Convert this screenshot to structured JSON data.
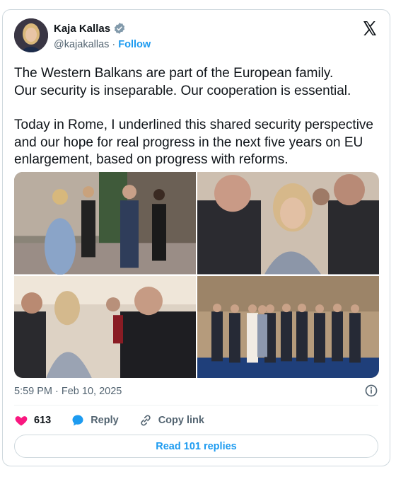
{
  "author": {
    "name": "Kaja Kallas",
    "handle": "@kajakallas",
    "separator": "·",
    "follow_label": "Follow",
    "verified_icon": "verified-badge-icon"
  },
  "tweet": {
    "paragraph1_line1": "The Western Balkans are part of the European family.",
    "paragraph1_line2": "Our security is inseparable. Our cooperation is essential.",
    "paragraph2": "Today in Rome, I underlined this shared security perspective and our hope for real progress in the next five years on EU enlargement, based on progress with reforms."
  },
  "timestamp": "5:59 PM · Feb 10, 2025",
  "actions": {
    "like_count": "613",
    "reply_label": "Reply",
    "copy_link_label": "Copy link"
  },
  "read_replies_label": "Read 101 replies",
  "colors": {
    "accent": "#1d9bf0",
    "like": "#f91880",
    "text": "#0f1419",
    "muted": "#536471"
  }
}
